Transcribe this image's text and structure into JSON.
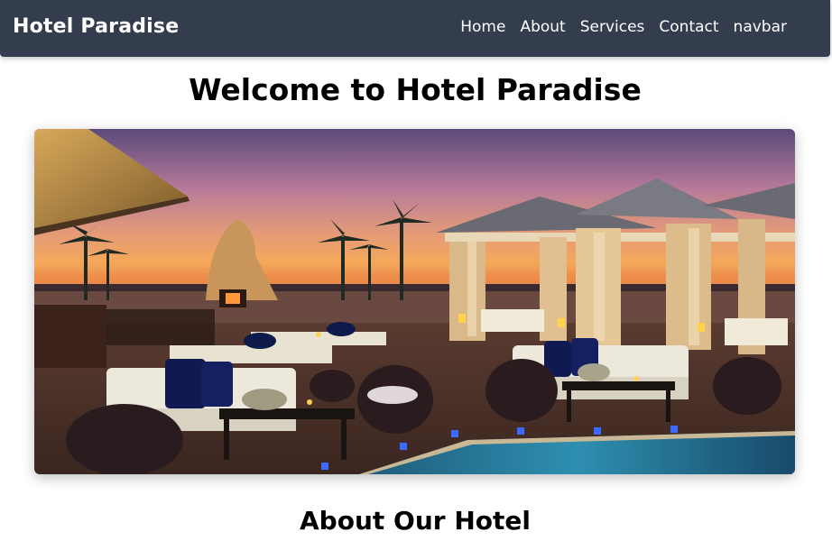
{
  "navbar": {
    "brand": "Hotel Paradise",
    "links": [
      "Home",
      "About",
      "Services",
      "Contact",
      "navbar"
    ]
  },
  "hero": {
    "title": "Welcome to Hotel Paradise"
  },
  "about": {
    "title": "About Our Hotel"
  },
  "colors": {
    "navbar_bg": "#343d4d",
    "text": "#000000"
  }
}
